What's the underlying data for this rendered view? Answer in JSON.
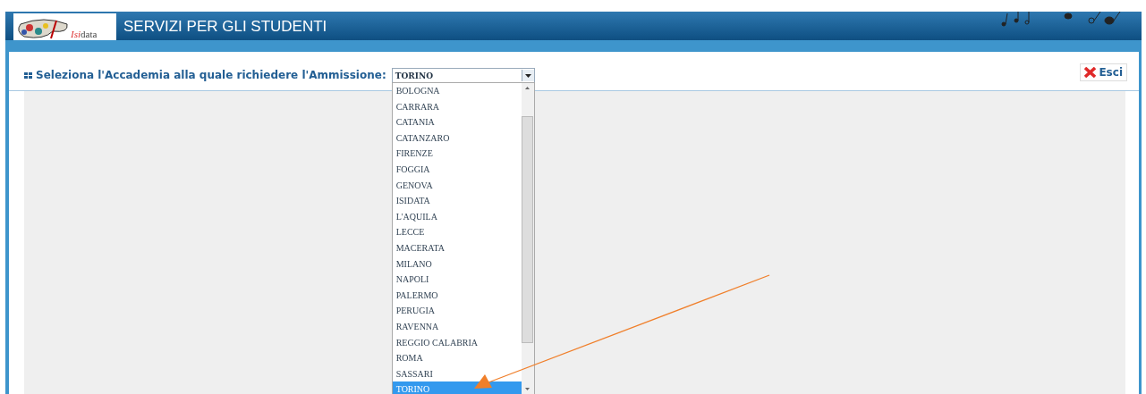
{
  "header": {
    "logo": {
      "prefix": "Isi",
      "text": "data"
    },
    "title": "SERVIZI PER GLI STUDENTI"
  },
  "form": {
    "label": "Seleziona l'Accademia alla quale richiedere l'Ammissione:",
    "select": {
      "value": "TORINO",
      "expanded": true,
      "options": [
        {
          "label": "BOLOGNA",
          "selected": false
        },
        {
          "label": "CARRARA",
          "selected": false
        },
        {
          "label": "CATANIA",
          "selected": false
        },
        {
          "label": "CATANZARO",
          "selected": false
        },
        {
          "label": "FIRENZE",
          "selected": false
        },
        {
          "label": "FOGGIA",
          "selected": false
        },
        {
          "label": "GENOVA",
          "selected": false
        },
        {
          "label": "ISIDATA",
          "selected": false
        },
        {
          "label": "L'AQUILA",
          "selected": false
        },
        {
          "label": "LECCE",
          "selected": false
        },
        {
          "label": "MACERATA",
          "selected": false
        },
        {
          "label": "MILANO",
          "selected": false
        },
        {
          "label": "NAPOLI",
          "selected": false
        },
        {
          "label": "PALERMO",
          "selected": false
        },
        {
          "label": "PERUGIA",
          "selected": false
        },
        {
          "label": "RAVENNA",
          "selected": false
        },
        {
          "label": "REGGIO CALABRIA",
          "selected": false
        },
        {
          "label": "ROMA",
          "selected": false
        },
        {
          "label": "SASSARI",
          "selected": false
        },
        {
          "label": "TORINO",
          "selected": true
        }
      ]
    }
  },
  "exit_button": {
    "label": "Esci"
  }
}
